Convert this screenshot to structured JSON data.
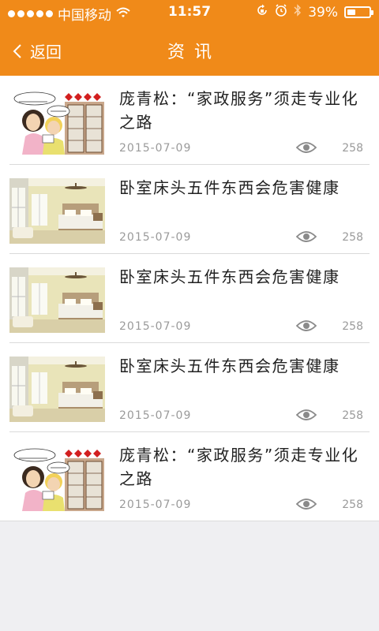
{
  "status_bar": {
    "carrier": "中国移动",
    "time": "11:57",
    "battery_text": "39%",
    "battery_level": 0.39
  },
  "nav": {
    "back_label": "返回",
    "title": "资讯"
  },
  "articles": [
    {
      "title": "庞青松：“家政服务”须走专业化之路",
      "date": "2015-07-09",
      "views": "258",
      "thumbnail": "cartoon"
    },
    {
      "title": "卧室床头五件东西会危害健康",
      "date": "2015-07-09",
      "views": "258",
      "thumbnail": "bedroom"
    },
    {
      "title": "卧室床头五件东西会危害健康",
      "date": "2015-07-09",
      "views": "258",
      "thumbnail": "bedroom"
    },
    {
      "title": "卧室床头五件东西会危害健康",
      "date": "2015-07-09",
      "views": "258",
      "thumbnail": "bedroom"
    },
    {
      "title": "庞青松：“家政服务”须走专业化之路",
      "date": "2015-07-09",
      "views": "258",
      "thumbnail": "cartoon"
    }
  ],
  "colors": {
    "header": "#f08a19",
    "background": "#efeff2",
    "meta_text": "#9a9a9a"
  }
}
